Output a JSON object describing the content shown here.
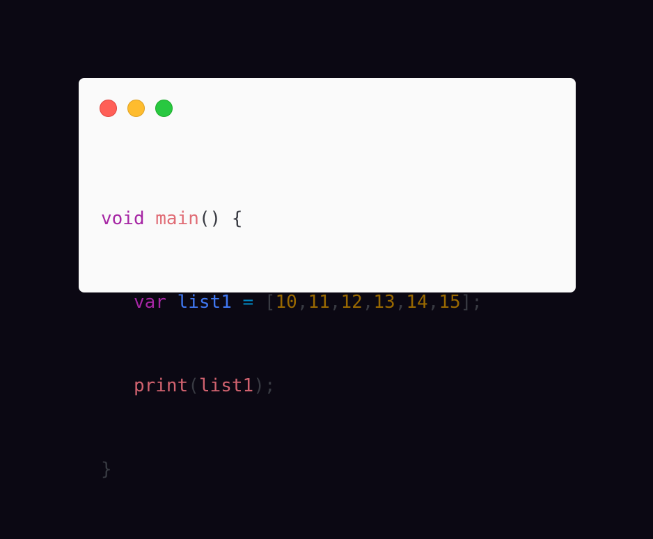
{
  "window": {
    "buttons": {
      "close_color": "#ff5f57",
      "minimize_color": "#febc2e",
      "maximize_color": "#28c840"
    }
  },
  "code": {
    "line1": {
      "kw": "void",
      "fn": "main",
      "rest": "() {"
    },
    "line2": {
      "kw": "var",
      "name": "list1",
      "op": "=",
      "open": "[",
      "nums": [
        "10",
        "11",
        "12",
        "13",
        "14",
        "15"
      ],
      "close": "];"
    },
    "line3": {
      "fn": "print",
      "open": "(",
      "arg": "list1",
      "close": ");"
    },
    "line4": {
      "text": "}"
    }
  }
}
